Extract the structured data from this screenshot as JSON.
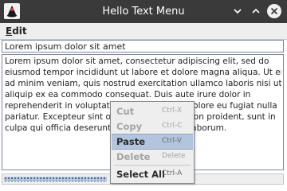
{
  "window": {
    "title": "Hello Text Menu",
    "icons": [
      "java-duke-icon",
      "minimize-icon",
      "maximize-icon",
      "close-icon"
    ]
  },
  "menubar": {
    "edit_label": "Edit"
  },
  "textfield": {
    "value": "Lorem ipsum dolor sit amet"
  },
  "textarea": {
    "lines": [
      "Lorem ipsum dolor sit amet, consectetur adipiscing elit, sed do",
      "eiusmod tempor incididunt ut labore et dolore magna aliqua. Ut enim",
      "ad minim veniam, quis nostrud exercitation ullamco laboris nisi ut",
      "aliquip ex ea commodo consequat. Duis aute irure dolor in",
      "reprehenderit in voluptate velit esse cillum dolore eu fugiat nulla",
      "pariatur. Excepteur sint occaecat cupidatat non proident, sunt in",
      "culpa qui officia deserunt mollit anim id est laborum."
    ]
  },
  "progress": {
    "fraction": 0.37
  },
  "context_menu": {
    "items": [
      {
        "label": "Cut",
        "accelerator": "Ctrl-X",
        "enabled": false,
        "highlighted": false
      },
      {
        "label": "Copy",
        "accelerator": "Ctrl-C",
        "enabled": false,
        "highlighted": false
      },
      {
        "label": "Paste",
        "accelerator": "Ctrl-V",
        "enabled": true,
        "highlighted": true
      },
      {
        "label": "Delete",
        "accelerator": "Delete",
        "enabled": false,
        "highlighted": false
      },
      {
        "label": "Select All",
        "accelerator": "Ctrl-A",
        "enabled": true,
        "highlighted": false
      }
    ]
  },
  "colors": {
    "titlebar": "#3a3a3a",
    "highlight": "#b3c5de",
    "progress_dots": "#2f4e7a"
  }
}
